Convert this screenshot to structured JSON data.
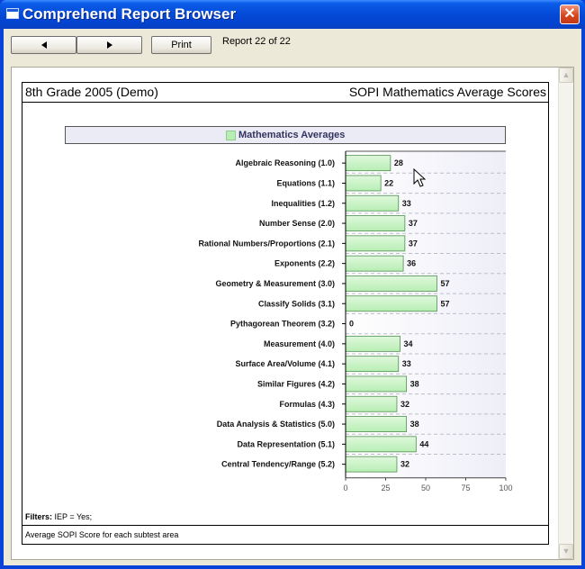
{
  "window": {
    "title": "Comprehend Report Browser"
  },
  "toolbar": {
    "print_label": "Print",
    "report_count": "Report 22 of 22"
  },
  "report": {
    "header_left": "8th Grade 2005 (Demo)",
    "header_right": "SOPI Mathematics Average Scores",
    "filters_label": "Filters:",
    "filters_value": "IEP = Yes;",
    "footer": "Average SOPI Score for each subtest area"
  },
  "colors": {
    "bar_fill": "#b8eeb4",
    "bar_stroke": "#4f8f4f",
    "plot_bg": "#eeeef8",
    "title_bar": "#0548d8"
  },
  "chart_data": {
    "type": "bar",
    "orientation": "horizontal",
    "legend": "Mathematics Averages",
    "legend_position": "top",
    "categories": [
      "Algebraic Reasoning (1.0)",
      "Equations (1.1)",
      "Inequalities (1.2)",
      "Number Sense (2.0)",
      "Rational Numbers/Proportions (2.1)",
      "Exponents (2.2)",
      "Geometry & Measurement (3.0)",
      "Classify Solids (3.1)",
      "Pythagorean Theorem (3.2)",
      "Measurement (4.0)",
      "Surface Area/Volume (4.1)",
      "Similar Figures (4.2)",
      "Formulas (4.3)",
      "Data Analysis & Statistics (5.0)",
      "Data Representation (5.1)",
      "Central Tendency/Range (5.2)"
    ],
    "series": [
      {
        "name": "Mathematics Averages",
        "values": [
          28,
          22,
          33,
          37,
          37,
          36,
          57,
          57,
          0,
          34,
          33,
          38,
          32,
          38,
          44,
          32
        ]
      }
    ],
    "xlim": [
      0,
      100
    ],
    "xticks": [
      0,
      25,
      50,
      75,
      100
    ],
    "grid": true
  }
}
